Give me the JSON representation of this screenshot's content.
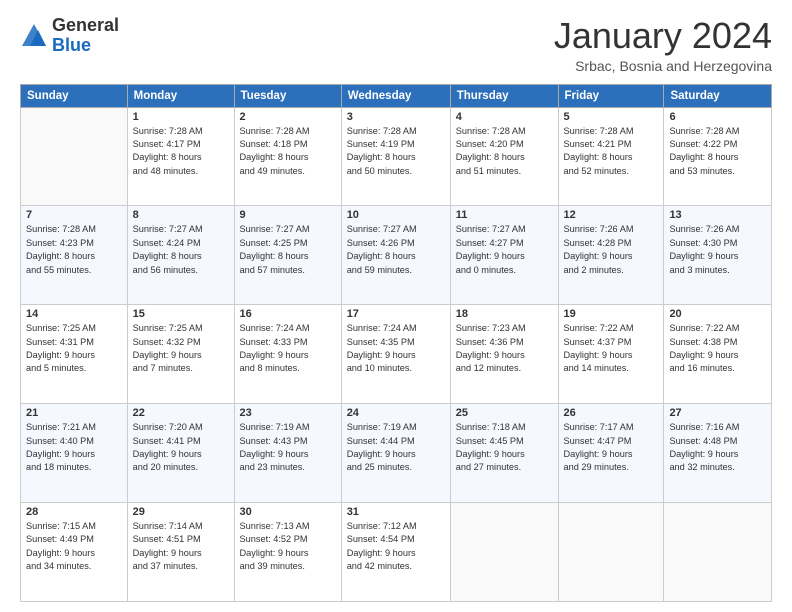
{
  "header": {
    "logo_general": "General",
    "logo_blue": "Blue",
    "month_title": "January 2024",
    "location": "Srbac, Bosnia and Herzegovina"
  },
  "days_of_week": [
    "Sunday",
    "Monday",
    "Tuesday",
    "Wednesday",
    "Thursday",
    "Friday",
    "Saturday"
  ],
  "weeks": [
    [
      {
        "day": "",
        "info": ""
      },
      {
        "day": "1",
        "info": "Sunrise: 7:28 AM\nSunset: 4:17 PM\nDaylight: 8 hours\nand 48 minutes."
      },
      {
        "day": "2",
        "info": "Sunrise: 7:28 AM\nSunset: 4:18 PM\nDaylight: 8 hours\nand 49 minutes."
      },
      {
        "day": "3",
        "info": "Sunrise: 7:28 AM\nSunset: 4:19 PM\nDaylight: 8 hours\nand 50 minutes."
      },
      {
        "day": "4",
        "info": "Sunrise: 7:28 AM\nSunset: 4:20 PM\nDaylight: 8 hours\nand 51 minutes."
      },
      {
        "day": "5",
        "info": "Sunrise: 7:28 AM\nSunset: 4:21 PM\nDaylight: 8 hours\nand 52 minutes."
      },
      {
        "day": "6",
        "info": "Sunrise: 7:28 AM\nSunset: 4:22 PM\nDaylight: 8 hours\nand 53 minutes."
      }
    ],
    [
      {
        "day": "7",
        "info": "Sunrise: 7:28 AM\nSunset: 4:23 PM\nDaylight: 8 hours\nand 55 minutes."
      },
      {
        "day": "8",
        "info": "Sunrise: 7:27 AM\nSunset: 4:24 PM\nDaylight: 8 hours\nand 56 minutes."
      },
      {
        "day": "9",
        "info": "Sunrise: 7:27 AM\nSunset: 4:25 PM\nDaylight: 8 hours\nand 57 minutes."
      },
      {
        "day": "10",
        "info": "Sunrise: 7:27 AM\nSunset: 4:26 PM\nDaylight: 8 hours\nand 59 minutes."
      },
      {
        "day": "11",
        "info": "Sunrise: 7:27 AM\nSunset: 4:27 PM\nDaylight: 9 hours\nand 0 minutes."
      },
      {
        "day": "12",
        "info": "Sunrise: 7:26 AM\nSunset: 4:28 PM\nDaylight: 9 hours\nand 2 minutes."
      },
      {
        "day": "13",
        "info": "Sunrise: 7:26 AM\nSunset: 4:30 PM\nDaylight: 9 hours\nand 3 minutes."
      }
    ],
    [
      {
        "day": "14",
        "info": "Sunrise: 7:25 AM\nSunset: 4:31 PM\nDaylight: 9 hours\nand 5 minutes."
      },
      {
        "day": "15",
        "info": "Sunrise: 7:25 AM\nSunset: 4:32 PM\nDaylight: 9 hours\nand 7 minutes."
      },
      {
        "day": "16",
        "info": "Sunrise: 7:24 AM\nSunset: 4:33 PM\nDaylight: 9 hours\nand 8 minutes."
      },
      {
        "day": "17",
        "info": "Sunrise: 7:24 AM\nSunset: 4:35 PM\nDaylight: 9 hours\nand 10 minutes."
      },
      {
        "day": "18",
        "info": "Sunrise: 7:23 AM\nSunset: 4:36 PM\nDaylight: 9 hours\nand 12 minutes."
      },
      {
        "day": "19",
        "info": "Sunrise: 7:22 AM\nSunset: 4:37 PM\nDaylight: 9 hours\nand 14 minutes."
      },
      {
        "day": "20",
        "info": "Sunrise: 7:22 AM\nSunset: 4:38 PM\nDaylight: 9 hours\nand 16 minutes."
      }
    ],
    [
      {
        "day": "21",
        "info": "Sunrise: 7:21 AM\nSunset: 4:40 PM\nDaylight: 9 hours\nand 18 minutes."
      },
      {
        "day": "22",
        "info": "Sunrise: 7:20 AM\nSunset: 4:41 PM\nDaylight: 9 hours\nand 20 minutes."
      },
      {
        "day": "23",
        "info": "Sunrise: 7:19 AM\nSunset: 4:43 PM\nDaylight: 9 hours\nand 23 minutes."
      },
      {
        "day": "24",
        "info": "Sunrise: 7:19 AM\nSunset: 4:44 PM\nDaylight: 9 hours\nand 25 minutes."
      },
      {
        "day": "25",
        "info": "Sunrise: 7:18 AM\nSunset: 4:45 PM\nDaylight: 9 hours\nand 27 minutes."
      },
      {
        "day": "26",
        "info": "Sunrise: 7:17 AM\nSunset: 4:47 PM\nDaylight: 9 hours\nand 29 minutes."
      },
      {
        "day": "27",
        "info": "Sunrise: 7:16 AM\nSunset: 4:48 PM\nDaylight: 9 hours\nand 32 minutes."
      }
    ],
    [
      {
        "day": "28",
        "info": "Sunrise: 7:15 AM\nSunset: 4:49 PM\nDaylight: 9 hours\nand 34 minutes."
      },
      {
        "day": "29",
        "info": "Sunrise: 7:14 AM\nSunset: 4:51 PM\nDaylight: 9 hours\nand 37 minutes."
      },
      {
        "day": "30",
        "info": "Sunrise: 7:13 AM\nSunset: 4:52 PM\nDaylight: 9 hours\nand 39 minutes."
      },
      {
        "day": "31",
        "info": "Sunrise: 7:12 AM\nSunset: 4:54 PM\nDaylight: 9 hours\nand 42 minutes."
      },
      {
        "day": "",
        "info": ""
      },
      {
        "day": "",
        "info": ""
      },
      {
        "day": "",
        "info": ""
      }
    ]
  ]
}
